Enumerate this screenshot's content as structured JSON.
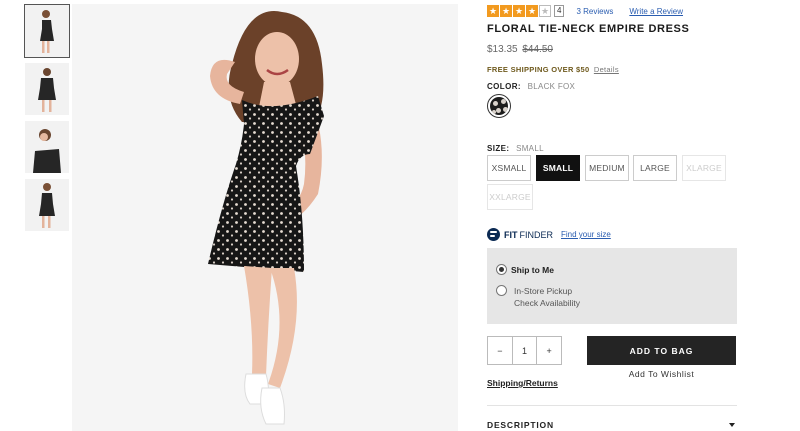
{
  "gallery": {
    "thumbnails": [
      "thumb-1",
      "thumb-2",
      "thumb-3",
      "thumb-4"
    ],
    "active_index": 0
  },
  "product": {
    "rating": {
      "value": 4,
      "max": 5,
      "count_label": "4",
      "reviews_link": "3 Reviews",
      "write_review": "Write a Review"
    },
    "title": "FLORAL TIE-NECK EMPIRE DRESS",
    "price": "$13.35",
    "old_price": "$44.50",
    "shipping_promo": "FREE SHIPPING OVER $50",
    "shipping_details": "Details",
    "color_label": "COLOR:",
    "color_value": "BLACK FOX",
    "size_label": "SIZE:",
    "size_value": "SMALL",
    "sizes": [
      {
        "label": "XSMALL",
        "state": "available"
      },
      {
        "label": "SMALL",
        "state": "selected"
      },
      {
        "label": "MEDIUM",
        "state": "available"
      },
      {
        "label": "LARGE",
        "state": "available"
      },
      {
        "label": "XLARGE",
        "state": "disabled"
      },
      {
        "label": "XXLARGE",
        "state": "disabled"
      }
    ],
    "fit_finder": {
      "strong": "FIT",
      "normal": "FINDER",
      "link": "Find your size"
    },
    "fulfillment": {
      "ship_to_me": "Ship to Me",
      "store_pickup": "In-Store Pickup",
      "check_availability": "Check Availability",
      "selected": "ship_to_me"
    },
    "quantity": {
      "minus": "−",
      "value": "1",
      "plus": "+"
    },
    "add_to_bag": "ADD TO BAG",
    "add_to_wishlist": "Add To Wishlist",
    "shipping_returns": "Shipping/Returns",
    "description_label": "DESCRIPTION"
  },
  "colors": {
    "star": "#f29a1f",
    "link": "#2a5db0",
    "promo": "#6f5a1e",
    "button_dark": "#242424",
    "fit_navy": "#0b2a53",
    "ship_box": "#e6e6e6"
  }
}
